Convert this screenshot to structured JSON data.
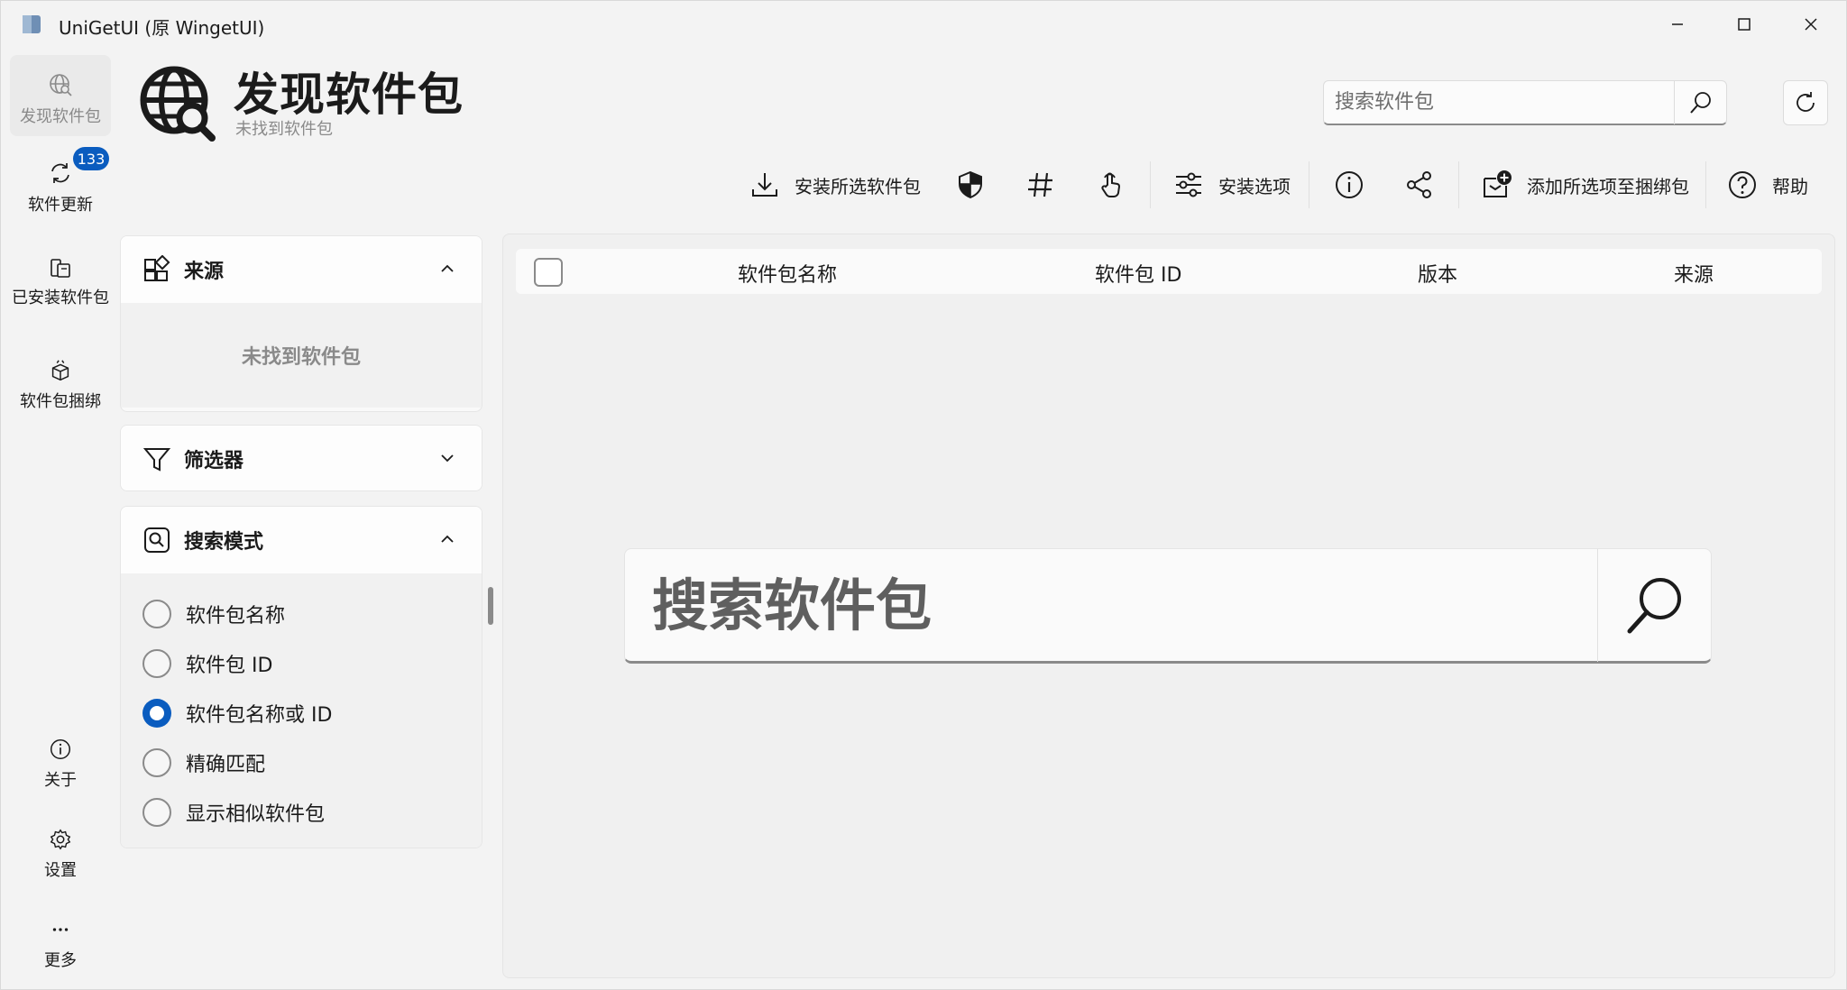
{
  "window": {
    "title": "UniGetUI (原 WingetUI)"
  },
  "nav": {
    "items": [
      {
        "label": "发现软件包",
        "icon": "globe-search-icon",
        "active": true
      },
      {
        "label": "软件更新",
        "icon": "refresh-icon",
        "badge": "133"
      },
      {
        "label": "已安装软件包",
        "icon": "installed-icon"
      },
      {
        "label": "软件包捆绑",
        "icon": "bundle-icon"
      },
      {
        "label": "关于",
        "icon": "info-icon"
      },
      {
        "label": "设置",
        "icon": "gear-icon"
      },
      {
        "label": "更多",
        "icon": "more-icon"
      }
    ]
  },
  "header": {
    "title": "发现软件包",
    "subtitle": "未找到软件包",
    "search_placeholder": "搜索软件包"
  },
  "toolbar": {
    "install_selected": "安装所选软件包",
    "install_options": "安装选项",
    "add_to_bundle": "添加所选项至捆绑包",
    "help": "帮助"
  },
  "sidebar": {
    "sources": {
      "title": "来源",
      "empty": "未找到软件包"
    },
    "filters": {
      "title": "筛选器"
    },
    "search_mode": {
      "title": "搜索模式",
      "options": [
        {
          "label": "软件包名称",
          "selected": false
        },
        {
          "label": "软件包 ID",
          "selected": false
        },
        {
          "label": "软件包名称或 ID",
          "selected": true
        },
        {
          "label": "精确匹配",
          "selected": false
        },
        {
          "label": "显示相似软件包",
          "selected": false
        }
      ]
    }
  },
  "table": {
    "columns": [
      "软件包名称",
      "软件包 ID",
      "版本",
      "来源"
    ]
  },
  "main_search": {
    "placeholder": "搜索软件包"
  },
  "colors": {
    "accent": "#0a5cbf",
    "background": "#f3f3f3"
  }
}
